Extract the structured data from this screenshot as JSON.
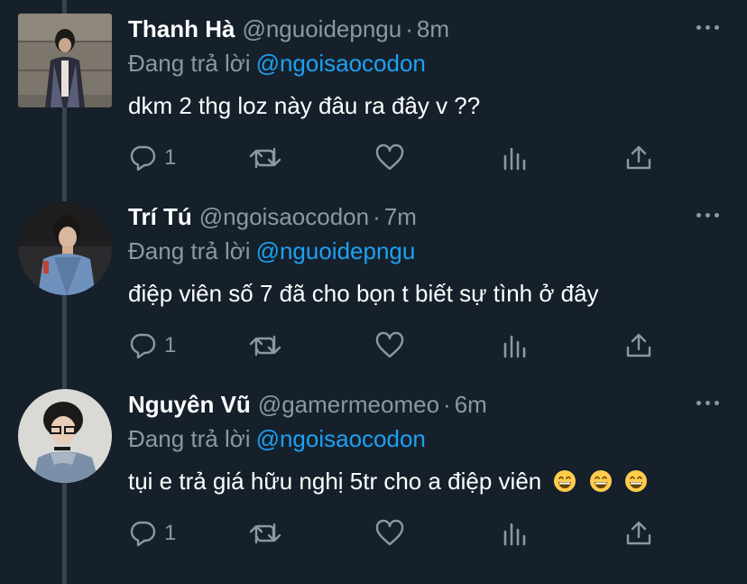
{
  "colors": {
    "background": "#15202b",
    "secondary_text": "#8899a6",
    "link": "#1da1f2",
    "thread_line": "#38444d"
  },
  "reply_prefix": "Đang trả lời",
  "tweets": [
    {
      "name": "Thanh Hà",
      "handle": "@nguoidepngu",
      "separator": "·",
      "time": "8m",
      "reply_to": "@ngoisaocodon",
      "text": "dkm 2 thg loz này đâu ra đây v ??",
      "reply_count": "1",
      "icons": [
        "reply-icon",
        "retweet-icon",
        "like-icon",
        "analytics-icon",
        "share-icon",
        "more-icon"
      ]
    },
    {
      "name": "Trí Tú",
      "handle": "@ngoisaocodon",
      "separator": "·",
      "time": "7m",
      "reply_to": "@nguoidepngu",
      "text": "điệp viên số 7 đã cho bọn t biết sự tình ở đây",
      "reply_count": "1",
      "icons": [
        "reply-icon",
        "retweet-icon",
        "like-icon",
        "analytics-icon",
        "share-icon",
        "more-icon"
      ]
    },
    {
      "name": "Nguyên Vũ",
      "handle": "@gamermeomeo",
      "separator": "·",
      "time": "6m",
      "reply_to": "@ngoisaocodon",
      "text": "tụi e trả giá hữu nghị 5tr cho a điệp viên",
      "emoji": [
        "😁",
        "😁",
        "😁"
      ],
      "reply_count": "1",
      "icons": [
        "reply-icon",
        "retweet-icon",
        "like-icon",
        "analytics-icon",
        "share-icon",
        "more-icon"
      ]
    }
  ]
}
